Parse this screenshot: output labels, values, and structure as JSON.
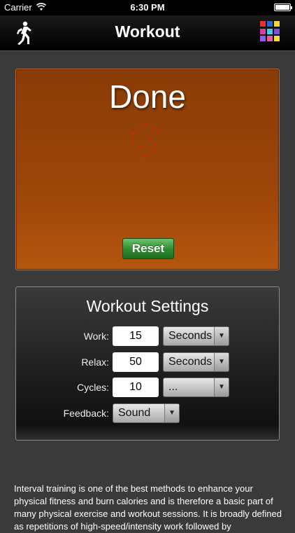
{
  "status_bar": {
    "carrier": "Carrier",
    "time": "6:30 PM"
  },
  "nav": {
    "title": "Workout",
    "left_icon": "runner-icon",
    "right_icon": "color-grid-icon",
    "grid_colors": [
      "#e5322d",
      "#2a62d8",
      "#f2d640",
      "#d23fa6",
      "#3fd0e8",
      "#7a4fd8",
      "#8a5fe0",
      "#e45ba3",
      "#f7d843"
    ]
  },
  "timer": {
    "status": "Done",
    "reset_label": "Reset",
    "panel_color": "#9c4508",
    "spinner_color": "#e0201a"
  },
  "settings": {
    "title": "Workout Settings",
    "work": {
      "label": "Work:",
      "value": "15",
      "unit": "Seconds"
    },
    "relax": {
      "label": "Relax:",
      "value": "50",
      "unit": "Seconds"
    },
    "cycles": {
      "label": "Cycles:",
      "value": "10",
      "unit": "..."
    },
    "feedback": {
      "label": "Feedback:",
      "value": "Sound"
    }
  },
  "description": "Interval training is one of the best methods to enhance your physical fitness and burn calories and is therefore a basic part of many physical exercise and workout sessions. It is broadly defined as repetitions of high-speed/intensity work followed by"
}
